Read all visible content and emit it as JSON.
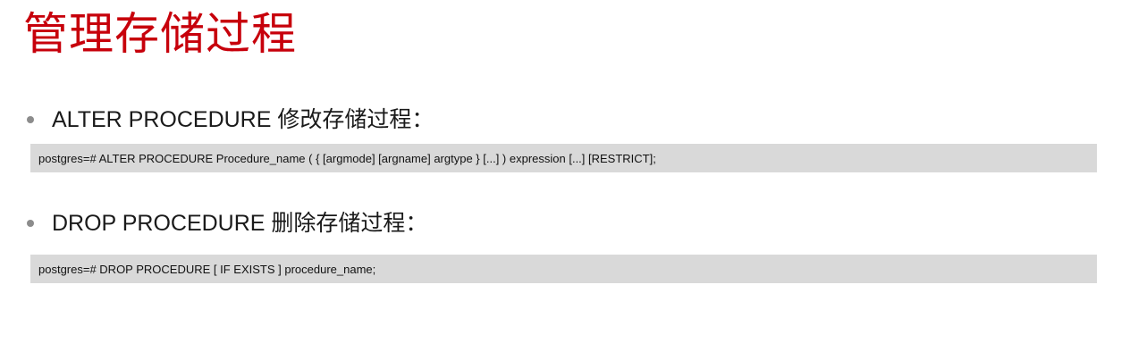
{
  "title": "管理存储过程",
  "sections": [
    {
      "heading": "ALTER PROCEDURE 修改存储过程：",
      "code": "postgres=# ALTER PROCEDURE Procedure_name ( { [argmode] [argname] argtype } [...] ) expression [...] [RESTRICT];"
    },
    {
      "heading": "DROP PROCEDURE 删除存储过程：",
      "code": "postgres=# DROP PROCEDURE [ IF EXISTS ] procedure_name;"
    }
  ],
  "colors": {
    "title": "#c7000b",
    "code_background": "#d9d9d9",
    "bullet": "#8c8c8c"
  }
}
